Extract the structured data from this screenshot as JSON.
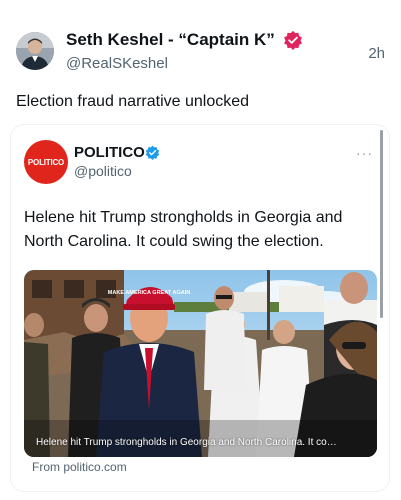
{
  "post": {
    "author_name": "Seth Keshel - “Captain K”",
    "author_handle": "@RealSKeshel",
    "time": "2h",
    "text": "Election fraud narrative unlocked"
  },
  "quote": {
    "logo_text": "POLITICO",
    "name": "POLITICO",
    "handle": "@politico",
    "text": "Helene hit Trump strongholds in Georgia and North Carolina. It could swing the election.",
    "media_caption": "Helene hit Trump strongholds in Georgia and North Carolina. It co…",
    "link_source": "From politico.com",
    "hat_text": "MAKE AMERICA GREAT AGAIN",
    "more_label": "···"
  },
  "colors": {
    "verified_pink": "#e0245e",
    "verified_blue": "#1d9bf0",
    "politico_red": "#e0261c"
  },
  "icons": {
    "author_badge": "verified-badge-icon",
    "quote_badge": "verified-badge-icon",
    "more": "more-icon"
  }
}
